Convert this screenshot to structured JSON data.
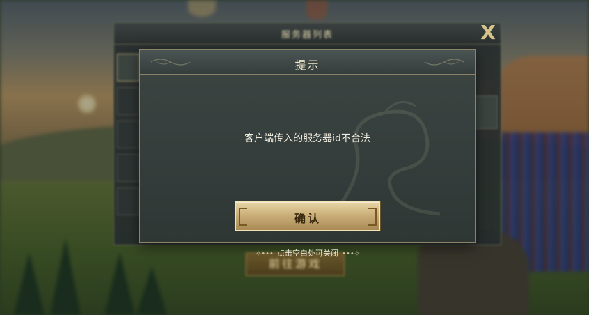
{
  "background_panel": {
    "title": "服务器列表",
    "close_symbol": "X",
    "enter_button_label": "前往游戏"
  },
  "dialog": {
    "title": "提示",
    "message": "客户端传入的服务器id不合法",
    "confirm_label": "确认"
  },
  "hint": {
    "text": "点击空白处可关闭",
    "ornament_left": "✧•••",
    "ornament_right": "•••✧"
  },
  "colors": {
    "dialog_border": "#8b8468",
    "button_gold": "#cbb07a",
    "title_text": "#ece4c4"
  },
  "icons": {
    "close": "close-icon",
    "dragon_watermark": "dragon-watermark-icon"
  }
}
